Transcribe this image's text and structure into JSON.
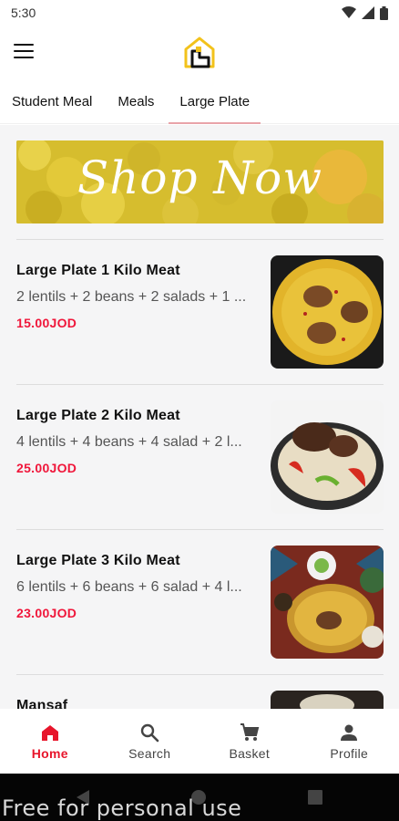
{
  "status_bar": {
    "time": "5:30"
  },
  "tabs": [
    {
      "label": "Student Meal",
      "active": false
    },
    {
      "label": "Meals",
      "active": false
    },
    {
      "label": "Large Plate",
      "active": true
    }
  ],
  "banner": {
    "text": "Shop Now"
  },
  "products": [
    {
      "title": "Large Plate 1 Kilo Meat",
      "description": "2 lentils + 2 beans + 2 salads + 1 ...",
      "price": "15.00JOD"
    },
    {
      "title": "Large Plate 2 Kilo Meat",
      "description": "4 lentils + 4 beans + 4 salad + 2 l...",
      "price": "25.00JOD"
    },
    {
      "title": "Large Plate 3 Kilo Meat",
      "description": "6 lentils + 6 beans + 6 salad + 4 l...",
      "price": "23.00JOD"
    },
    {
      "title": "Mansaf",
      "description": "",
      "price": ""
    }
  ],
  "bottom_nav": [
    {
      "label": "Home",
      "icon": "home-icon",
      "active": true
    },
    {
      "label": "Search",
      "icon": "search-icon",
      "active": false
    },
    {
      "label": "Basket",
      "icon": "cart-icon",
      "active": false
    },
    {
      "label": "Profile",
      "icon": "person-icon",
      "active": false
    }
  ],
  "watermark": "Free for personal use",
  "colors": {
    "accent": "#e7152b",
    "price": "#f0163a",
    "tab_indicator": "#e9a3a9",
    "logo_yellow": "#f2c21b"
  }
}
